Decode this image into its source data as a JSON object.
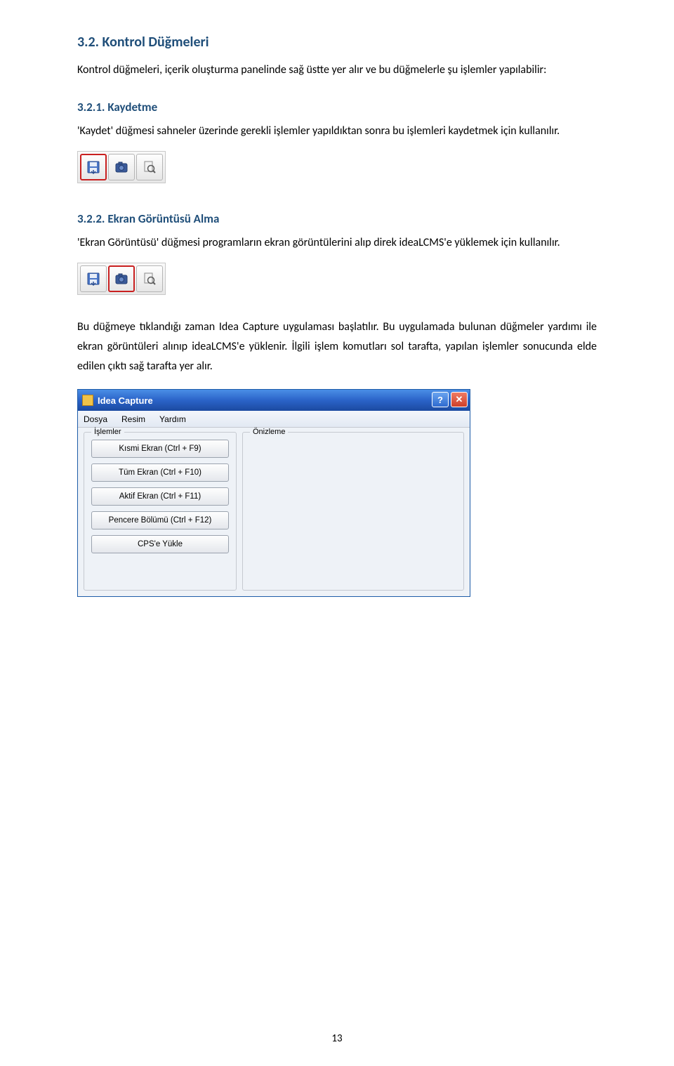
{
  "heading_32": "3.2. Kontrol Düğmeleri",
  "para_32": "Kontrol düğmeleri, içerik oluşturma panelinde sağ üstte yer alır ve bu düğmelerle şu işlemler yapılabilir:",
  "heading_321": "3.2.1. Kaydetme",
  "para_321": "'Kaydet' düğmesi sahneler üzerinde gerekli işlemler yapıldıktan sonra bu işlemleri kaydetmek için kullanılır.",
  "heading_322": "3.2.2. Ekran Görüntüsü Alma",
  "para_322": "'Ekran Görüntüsü' düğmesi programların ekran görüntülerini alıp direk ideaLCMS'e yüklemek için kullanılır.",
  "para_capture": "Bu düğmeye tıklandığı zaman Idea Capture uygulaması başlatılır. Bu uygulamada bulunan düğmeler yardımı ile ekran görüntüleri alınıp ideaLCMS'e yüklenir. İlgili işlem komutları sol tarafta, yapılan işlemler sonucunda elde edilen çıktı sağ tarafta yer alır.",
  "capture": {
    "title": "Idea Capture",
    "menu": {
      "file": "Dosya",
      "image": "Resim",
      "help": "Yardım"
    },
    "group_left": "İşlemler",
    "group_right": "Önizleme",
    "buttons": {
      "partial": "Kısmi Ekran (Ctrl + F9)",
      "full": "Tüm Ekran (Ctrl + F10)",
      "active": "Aktif Ekran (Ctrl + F11)",
      "region": "Pencere Bölümü (Ctrl + F12)",
      "upload": "CPS'e Yükle"
    }
  },
  "page_number": "13"
}
